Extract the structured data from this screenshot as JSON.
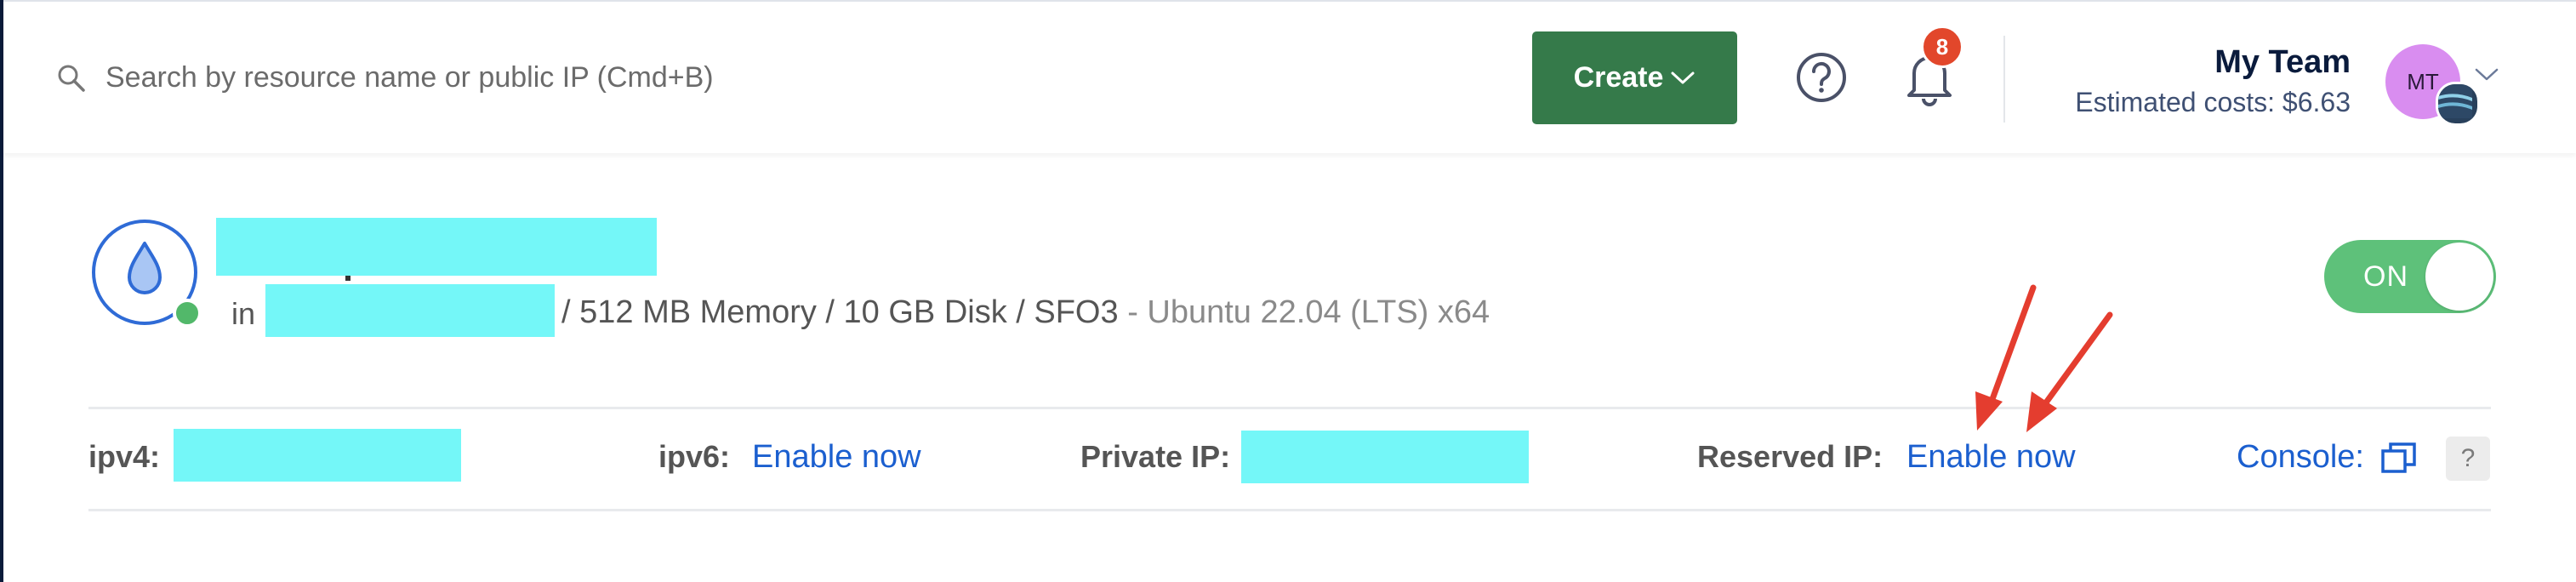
{
  "header": {
    "search_placeholder": "Search by resource name or public IP (Cmd+B)",
    "create_label": "Create",
    "notification_count": "8",
    "team_name": "My Team",
    "estimated_costs": "Estimated costs: $6.63",
    "avatar_initials": "MT"
  },
  "droplet": {
    "in_label": "in",
    "specs": "/ 512 MB Memory / 10 GB Disk / SFO3",
    "os": " - Ubuntu 22.04 (LTS) x64",
    "power_label": "ON"
  },
  "networking": {
    "ipv4_label": "ipv4:",
    "ipv6_label": "ipv6:",
    "ipv6_action": "Enable now",
    "private_ip_label": "Private IP:",
    "reserved_ip_label": "Reserved IP:",
    "reserved_ip_action": "Enable now",
    "console_label": "Console:",
    "help_label": "?"
  },
  "colors": {
    "create_button": "#357a4a",
    "link": "#1b5fcf",
    "toggle_on": "#5ec17a",
    "notification_badge": "#e2472b",
    "redaction": "#74f7f8",
    "annotation_arrow": "#e43d2f"
  }
}
